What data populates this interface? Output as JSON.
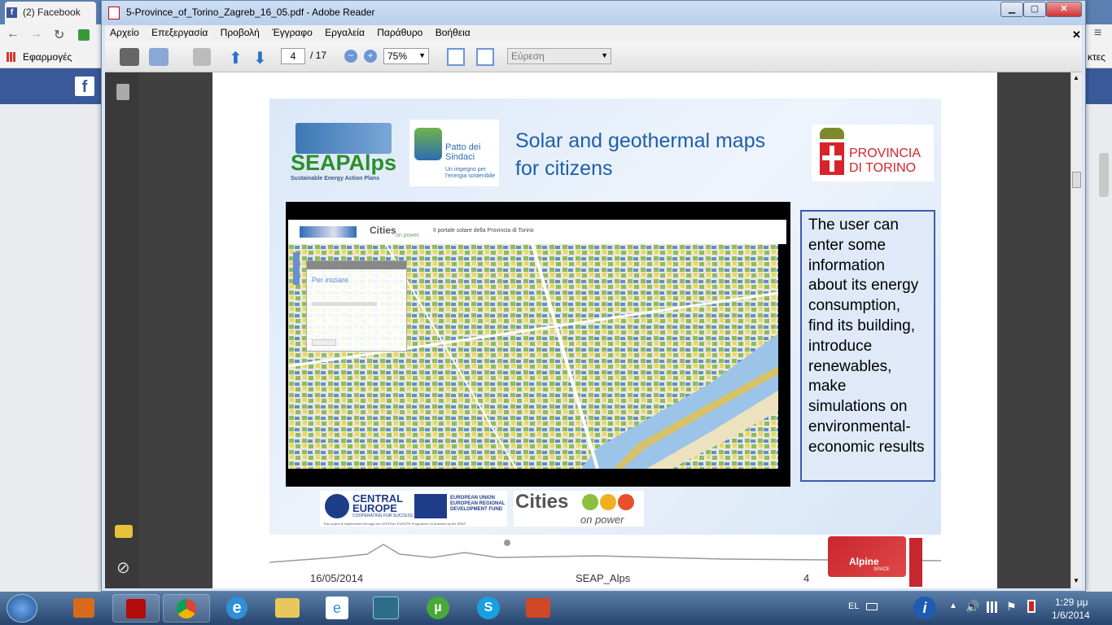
{
  "browser": {
    "tab_title": "(2) Facebook",
    "bookmarks_label": "Εφαρμογές",
    "bookmarks_right": "κτες"
  },
  "reader": {
    "window_title": "5-Province_of_Torino_Zagreb_16_05.pdf - Adobe Reader",
    "menu": [
      "Αρχείο",
      "Επεξεργασία",
      "Προβολή",
      "Έγγραφο",
      "Εργαλεία",
      "Παράθυρο",
      "Βοήθεια"
    ],
    "page_current": "4",
    "page_total": "/ 17",
    "zoom": "75%",
    "find_placeholder": "Εύρεση"
  },
  "slide": {
    "seap_logo": "SEAPAlps",
    "seap_sub": "Sustainable Energy Action Plans",
    "patto_logo": "Patto dei Sindaci",
    "patto_sub": "Un impegno per l'energia sostenibile",
    "title_line1": "Solar and geothermal maps",
    "title_line2": "for citizens",
    "provincia_line1": "PROVINCIA",
    "provincia_line2": "DI TORINO",
    "map_header": "Il portale solare della Provincia di Torino",
    "map_cities": "Cities",
    "map_onpower": "on power",
    "map_panel_title": "Per iniziare",
    "info_text": "The user can enter some information about its energy consumption, find its building, introduce renewables, make simulations on environmental-economic results",
    "footer_ce": "CENTRAL EUROPE",
    "footer_ce_sub": "COOPERATING FOR SUCCESS.",
    "footer_eu": "EUROPEAN UNION EUROPEAN REGIONAL DEVELOPMENT FUND",
    "footer_cities": "Cities",
    "footer_onpower": "on power",
    "footer_note": "This project is implemented through the CENTRAL EUROPE Programme co-financed by the ERDF",
    "date": "16/05/2014",
    "project": "SEAP_Alps",
    "page_no": "4",
    "alpine": "Alpine",
    "alpine_space": "SPACE"
  },
  "taskbar": {
    "lang": "EL",
    "time": "1:29 μμ",
    "date": "1/6/2014"
  },
  "colors": {
    "reader_frame": "#dbe6f4",
    "viewer_bg": "#404040",
    "title_blue": "#1f5fa8",
    "provincia_red": "#d8232a",
    "fb_blue": "#3b5998"
  }
}
